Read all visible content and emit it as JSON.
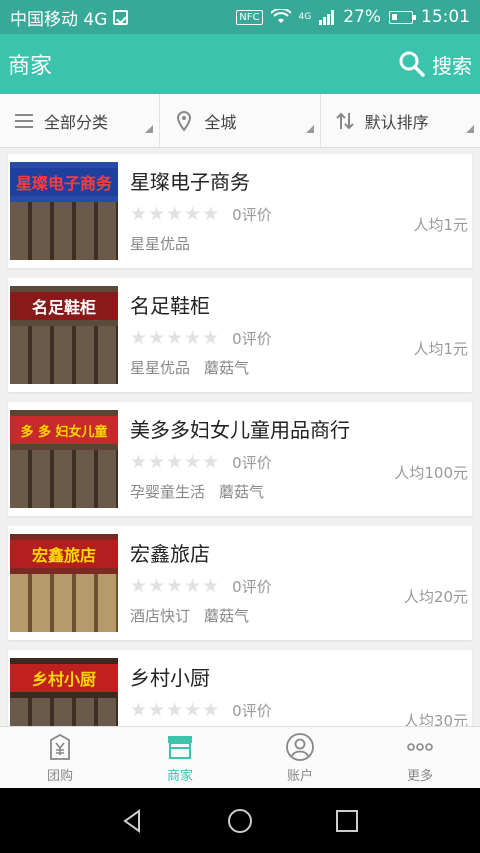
{
  "status": {
    "carrier": "中国移动 4G",
    "nfc": "NFC",
    "network": "4G",
    "battery": "27%",
    "time": "15:01"
  },
  "header": {
    "title": "商家",
    "search_label": "搜索"
  },
  "filters": [
    {
      "label": "全部分类",
      "icon": "menu-icon"
    },
    {
      "label": "全城",
      "icon": "location-icon"
    },
    {
      "label": "默认排序",
      "icon": "sort-icon"
    }
  ],
  "merchants": [
    {
      "name": "星璨电子商务",
      "reviews": "0评价",
      "price": "人均1元",
      "tags": [
        "星星优品"
      ],
      "sign_text": "星璨电子商务",
      "sign_color": "#1f3fa0",
      "sign_text_color": "#ff3b3b"
    },
    {
      "name": "名足鞋柜",
      "reviews": "0评价",
      "price": "人均1元",
      "tags": [
        "星星优品",
        "蘑菇气"
      ],
      "sign_text": "名足鞋柜",
      "sign_color": "#8a1a1a",
      "sign_text_color": "#ffffff"
    },
    {
      "name": "美多多妇女儿童用品商行",
      "reviews": "0评价",
      "price": "人均100元",
      "tags": [
        "孕婴童生活",
        "蘑菇气"
      ],
      "sign_text": "多 多 妇女儿童",
      "sign_color": "#c72a2a",
      "sign_text_color": "#ffd800"
    },
    {
      "name": "宏鑫旅店",
      "reviews": "0评价",
      "price": "人均20元",
      "tags": [
        "酒店快订",
        "蘑菇气"
      ],
      "sign_text": "宏鑫旅店",
      "sign_color": "#b51e1e",
      "sign_text_color": "#ffd800"
    },
    {
      "name": "乡村小厨",
      "reviews": "0评价",
      "price": "人均30元",
      "tags": [],
      "sign_text": "乡村小厨",
      "sign_color": "#c0201e",
      "sign_text_color": "#ffd800"
    }
  ],
  "tabs": [
    {
      "label": "团购",
      "icon": "yen-bag-icon",
      "active": false
    },
    {
      "label": "商家",
      "icon": "store-icon",
      "active": true
    },
    {
      "label": "账户",
      "icon": "account-icon",
      "active": false
    },
    {
      "label": "更多",
      "icon": "more-icon",
      "active": false
    }
  ],
  "colors": {
    "accent": "#3cc3ae",
    "status_bar": "#37a998"
  }
}
